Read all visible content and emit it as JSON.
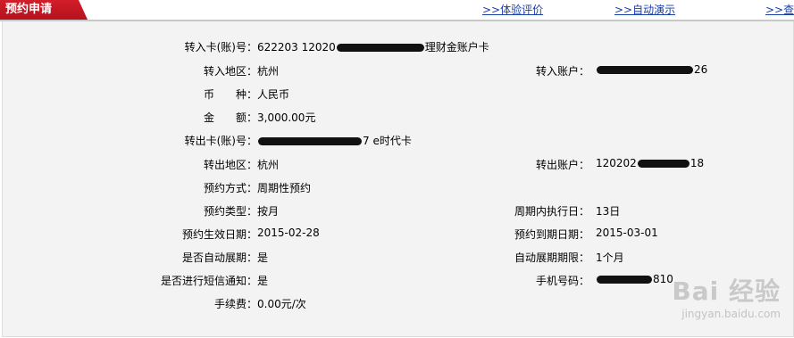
{
  "header": {
    "title": "预约申请",
    "links": [
      ">>体验评价",
      ">>自动演示",
      ">>查看"
    ]
  },
  "form": {
    "in_card_label": "转入卡(账)号：",
    "in_card_prefix": "622203 12020",
    "in_card_suffix": "理财金账户卡",
    "in_region_label": "转入地区：",
    "in_region": "杭州",
    "in_account_label": "转入账户：",
    "in_account_suffix": "26",
    "currency_label": "币　　种：",
    "currency": "人民币",
    "amount_label": "金　　额：",
    "amount": "3,000.00元",
    "out_card_label": "转出卡(账)号：",
    "out_card_suffix": "7 e时代卡",
    "out_region_label": "转出地区：",
    "out_region": "杭州",
    "out_account_label": "转出账户：",
    "out_account_prefix": "120202",
    "out_account_suffix": "18",
    "method_label": "预约方式：",
    "method": "周期性预约",
    "type_label": "预约类型：",
    "type": "按月",
    "exec_day_label": "周期内执行日：",
    "exec_day": "13日",
    "start_label": "预约生效日期：",
    "start_date": "2015-02-28",
    "end_label": "预约到期日期：",
    "end_date": "2015-03-01",
    "auto_extend_label": "是否自动展期：",
    "auto_extend": "是",
    "extend_period_label": "自动展期期限：",
    "extend_period": "1个月",
    "sms_label": "是否进行短信通知：",
    "sms": "是",
    "phone_label": "手机号码：",
    "phone_suffix": "810",
    "fee_label": "手续费：",
    "fee": "0.00元/次"
  },
  "watermark": {
    "brand": "Bai 经验",
    "url": "jingyan.baidu.com"
  }
}
